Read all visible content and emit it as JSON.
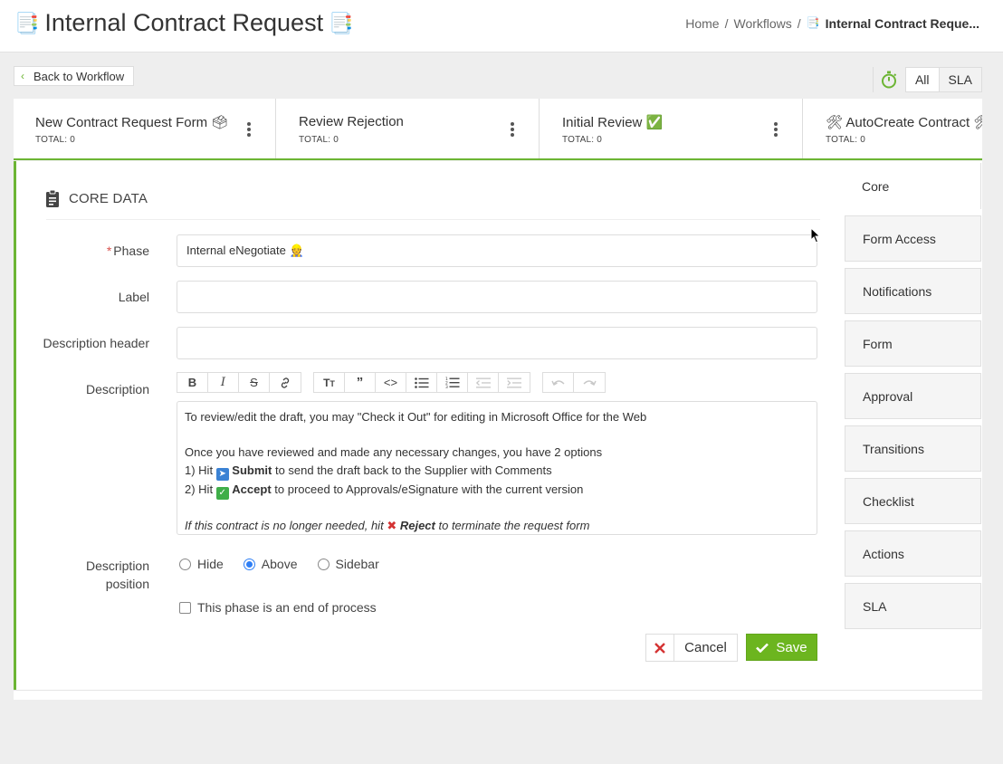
{
  "header": {
    "title": "Internal Contract Request",
    "breadcrumb": {
      "home": "Home",
      "workflows": "Workflows",
      "current": "Internal Contract Reque..."
    }
  },
  "toolbar": {
    "back_label": "Back to Workflow",
    "filter_all": "All",
    "filter_sla": "SLA"
  },
  "phases": [
    {
      "name": "New Contract Request Form 🗳",
      "total": "TOTAL: 0"
    },
    {
      "name": "Review Rejection",
      "total": "TOTAL: 0"
    },
    {
      "name": "Initial Review ✅",
      "total": "TOTAL: 0"
    },
    {
      "name": "🛠 AutoCreate Contract 🛠",
      "total": "TOTAL: 0"
    }
  ],
  "core": {
    "section_title": "CORE DATA",
    "phase_label": "Phase",
    "phase_value": "Internal eNegotiate 👷",
    "label_label": "Label",
    "label_value": "",
    "desc_header_label": "Description header",
    "desc_header_value": "",
    "description_label": "Description",
    "description": {
      "line1": "To review/edit the draft, you may \"Check it Out\" for editing in Microsoft Office for the Web",
      "line2": "Once you have reviewed and made any necessary changes, you have 2 options",
      "line3_a": "1) Hit ",
      "line3_b": "Submit",
      "line3_c": " to send the draft back to the Supplier with Comments",
      "line4_a": "2) Hit ",
      "line4_b": "Accept",
      "line4_c": " to proceed to Approvals/eSignature with the current version",
      "line5_a": "If this contract is no longer needed, hit ",
      "line5_b": "Reject",
      "line5_c": " to terminate the request form"
    },
    "position_label_1": "Description",
    "position_label_2": "position",
    "position_options": [
      "Hide",
      "Above",
      "Sidebar"
    ],
    "position_selected": "Above",
    "end_process_label": "This phase is an end of process",
    "cancel_label": "Cancel",
    "save_label": "Save"
  },
  "side_tabs": [
    "Core",
    "Form Access",
    "Notifications",
    "Form",
    "Approval",
    "Transitions",
    "Checklist",
    "Actions",
    "SLA"
  ],
  "colors": {
    "accent": "#6cb534",
    "save": "#6cb51f",
    "radio": "#2f7ff5",
    "cancel_x": "#d43333"
  }
}
